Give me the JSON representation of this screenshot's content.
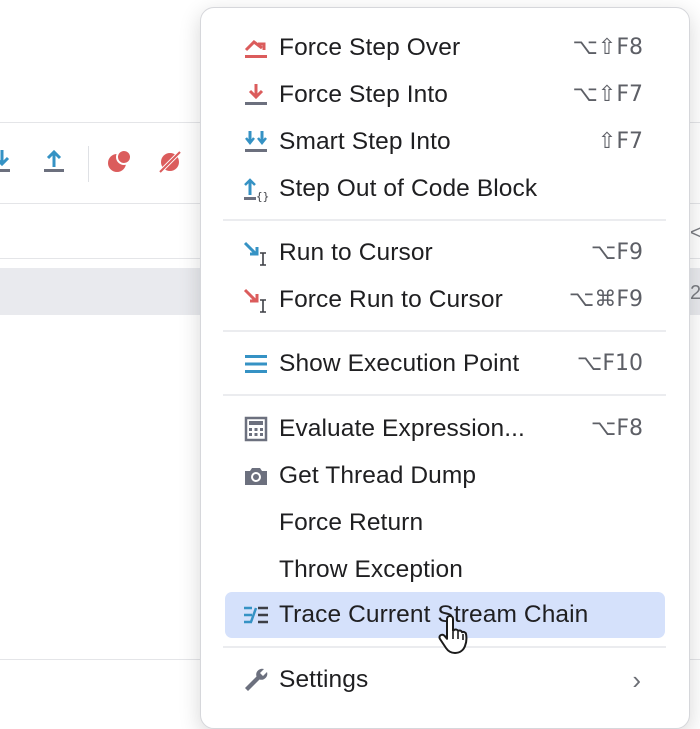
{
  "menu": {
    "items": [
      {
        "label": "Force Step Over",
        "shortcut": "⌥⇧F8",
        "icon": "force-step-over-icon"
      },
      {
        "label": "Force Step Into",
        "shortcut": "⌥⇧F7",
        "icon": "force-step-into-icon"
      },
      {
        "label": "Smart Step Into",
        "shortcut": "⇧F7",
        "icon": "smart-step-into-icon"
      },
      {
        "label": "Step Out of Code Block",
        "shortcut": "",
        "icon": "step-out-code-block-icon"
      },
      {
        "label": "Run to Cursor",
        "shortcut": "⌥F9",
        "icon": "run-to-cursor-icon"
      },
      {
        "label": "Force Run to Cursor",
        "shortcut": "⌥⌘F9",
        "icon": "force-run-to-cursor-icon"
      },
      {
        "label": "Show Execution Point",
        "shortcut": "⌥F10",
        "icon": "show-execution-point-icon"
      },
      {
        "label": "Evaluate Expression...",
        "shortcut": "⌥F8",
        "icon": "calculator-icon"
      },
      {
        "label": "Get Thread Dump",
        "shortcut": "",
        "icon": "camera-icon"
      },
      {
        "label": "Force Return",
        "shortcut": "",
        "icon": ""
      },
      {
        "label": "Throw Exception",
        "shortcut": "",
        "icon": ""
      },
      {
        "label": "Trace Current Stream Chain",
        "shortcut": "",
        "icon": "stream-trace-icon",
        "selected": true
      },
      {
        "label": "Settings",
        "shortcut": "",
        "icon": "wrench-icon",
        "submenu": true
      }
    ]
  },
  "background": {
    "edge_glyph_top": "<",
    "edge_glyph_row": "2"
  },
  "colors": {
    "red_icon": "#db5c5c",
    "blue_icon": "#3592c4",
    "selection": "#d5e1fb",
    "menu_text": "#1f1f21",
    "shortcut_text": "#5d5f66"
  }
}
